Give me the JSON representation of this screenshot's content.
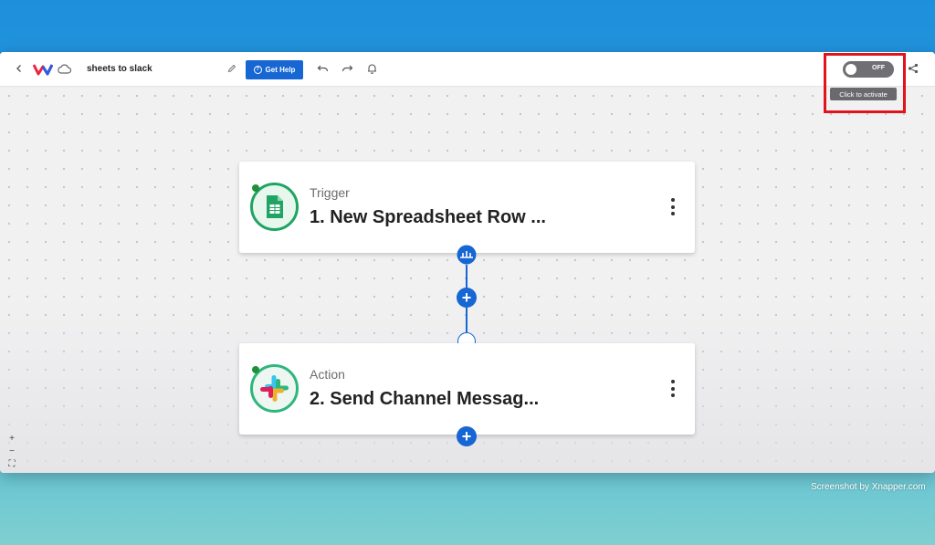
{
  "toolbar": {
    "workflow_name": "sheets to slack",
    "help_label": "Get Help",
    "toggle_state": "OFF",
    "toggle_tooltip": "Click to activate",
    "icons": [
      "chevron-left-icon",
      "logo-icon",
      "cloud-icon",
      "pencil-icon",
      "help-icon",
      "undo-icon",
      "redo-icon",
      "bell-icon",
      "share-icon"
    ]
  },
  "steps": [
    {
      "kind": "Trigger",
      "name": "1. New Spreadsheet Row ...",
      "app_icon": "google-sheets-icon",
      "accent": "#1fa463"
    },
    {
      "kind": "Action",
      "name": "2. Send Channel Messag...",
      "app_icon": "slack-icon",
      "accent": "#2eb67d"
    }
  ],
  "canvas": {
    "zoom_controls": [
      "+",
      "−",
      "⛶"
    ]
  },
  "watermark": "Screenshot by Xnapper.com",
  "colors": {
    "primary": "#1666d4",
    "highlight": "#e0141b",
    "toggle_off": "#707074"
  }
}
